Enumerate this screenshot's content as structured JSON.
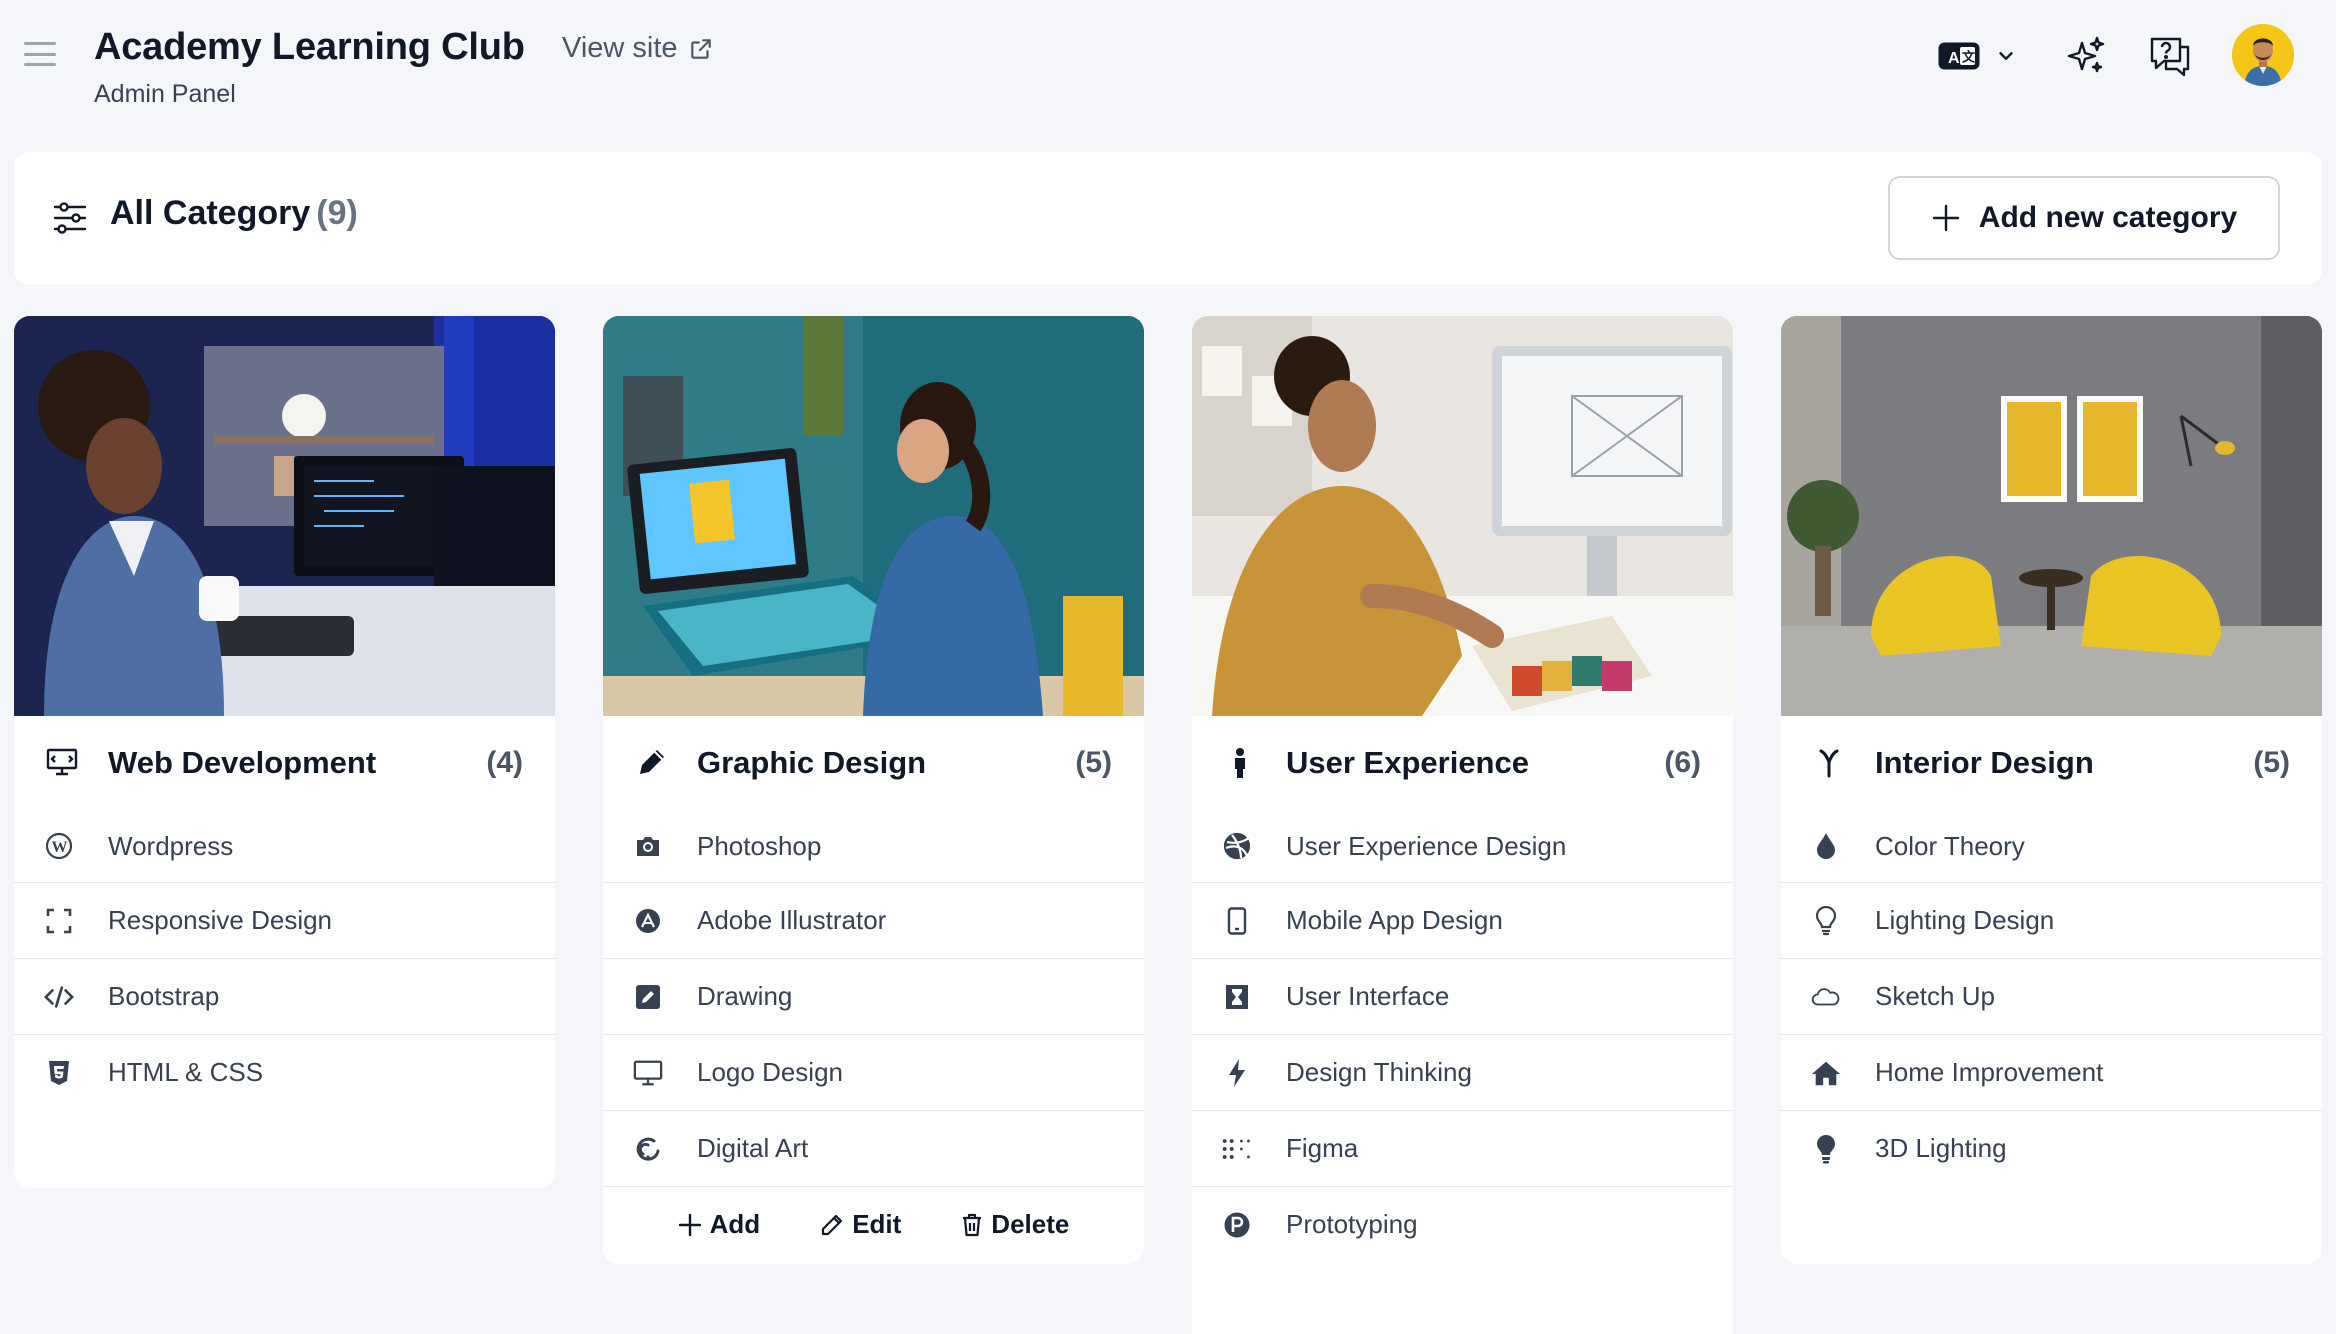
{
  "header": {
    "title": "Academy Learning Club",
    "subtitle": "Admin Panel",
    "view_site": "View site",
    "avatar_alt": "User avatar"
  },
  "toolbar": {
    "title": "All Category",
    "count": "(9)",
    "add_button": "Add new category"
  },
  "colors": {
    "accent": "#111827",
    "background": "#f5f6fa",
    "card": "#ffffff",
    "avatar_bg": "#f5c518"
  },
  "cards": [
    {
      "title": "Web Development",
      "count": "(4)",
      "icon": "code-monitor-icon",
      "items": [
        {
          "label": "Wordpress",
          "icon": "wordpress-icon"
        },
        {
          "label": "Responsive Design",
          "icon": "expand-icon"
        },
        {
          "label": "Bootstrap",
          "icon": "code-icon"
        },
        {
          "label": "HTML & CSS",
          "icon": "html5-icon"
        }
      ]
    },
    {
      "title": "Graphic Design",
      "count": "(5)",
      "icon": "pen-icon",
      "items": [
        {
          "label": "Photoshop",
          "icon": "camera-icon"
        },
        {
          "label": "Adobe Illustrator",
          "icon": "compass-icon"
        },
        {
          "label": "Drawing",
          "icon": "edit-square-icon"
        },
        {
          "label": "Logo Design",
          "icon": "monitor-icon"
        },
        {
          "label": "Digital Art",
          "icon": "swirl-icon"
        }
      ],
      "actions": {
        "add": "Add",
        "edit": "Edit",
        "delete": "Delete"
      }
    },
    {
      "title": "User Experience",
      "count": "(6)",
      "icon": "person-icon",
      "items": [
        {
          "label": "User Experience Design",
          "icon": "dribbble-icon"
        },
        {
          "label": "Mobile App Design",
          "icon": "mobile-icon"
        },
        {
          "label": "User Interface",
          "icon": "hourglass-icon"
        },
        {
          "label": "Design Thinking",
          "icon": "bolt-icon"
        },
        {
          "label": "Figma",
          "icon": "dots-grid-icon"
        },
        {
          "label": "Prototyping",
          "icon": "p-badge-icon"
        }
      ]
    },
    {
      "title": "Interior Design",
      "count": "(5)",
      "icon": "y-icon",
      "items": [
        {
          "label": "Color Theory",
          "icon": "drop-icon"
        },
        {
          "label": "Lighting Design",
          "icon": "bulb-outline-icon"
        },
        {
          "label": "Sketch Up",
          "icon": "cloud-icon"
        },
        {
          "label": "Home Improvement",
          "icon": "home-icon"
        },
        {
          "label": "3D Lighting",
          "icon": "bulb-icon"
        }
      ]
    }
  ]
}
